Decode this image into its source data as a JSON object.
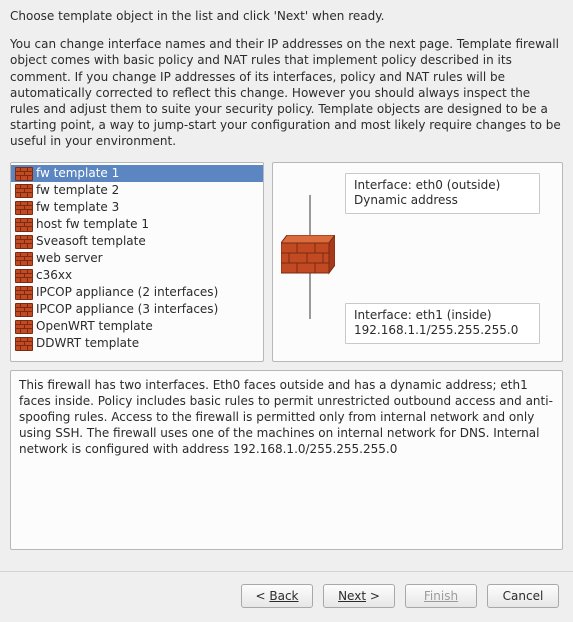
{
  "intro": {
    "line1": "Choose template object in the list and click 'Next' when ready.",
    "line2": "You can change  interface names and their IP addresses on the next page. Template firewall object comes with basic policy and NAT rules that implement policy described in its comment. If you change IP addresses of its interfaces, policy and NAT rules will be automatically corrected to reflect this change. However you should always inspect the rules and adjust them to suite your security policy. Template objects are designed to be a starting point, a way to jump-start your configuration and most likely require changes to be useful in your environment."
  },
  "templates": [
    {
      "label": "fw template 1",
      "selected": true
    },
    {
      "label": "fw template 2",
      "selected": false
    },
    {
      "label": "fw template 3",
      "selected": false
    },
    {
      "label": "host fw template 1",
      "selected": false
    },
    {
      "label": "Sveasoft template",
      "selected": false
    },
    {
      "label": "web server",
      "selected": false
    },
    {
      "label": "c36xx",
      "selected": false
    },
    {
      "label": "IPCOP appliance (2 interfaces)",
      "selected": false
    },
    {
      "label": "IPCOP appliance (3 interfaces)",
      "selected": false
    },
    {
      "label": "OpenWRT template",
      "selected": false
    },
    {
      "label": "DDWRT template",
      "selected": false
    }
  ],
  "preview": {
    "iface0": {
      "title": "Interface: eth0 (outside)",
      "addr": "Dynamic address"
    },
    "iface1": {
      "title": "Interface: eth1 (inside)",
      "addr": "192.168.1.1/255.255.255.0"
    }
  },
  "description": "This firewall has two interfaces. Eth0 faces outside and has a dynamic address; eth1 faces inside. Policy includes basic rules to permit unrestricted outbound access and anti-spoofing rules. Access to the firewall is permitted only from internal network and only using SSH. The firewall uses one of the machines on internal network for DNS. Internal network is configured with address 192.168.1.0/255.255.255.0",
  "buttons": {
    "back": "Back",
    "next": "Next",
    "finish": "Finish",
    "cancel": "Cancel"
  }
}
